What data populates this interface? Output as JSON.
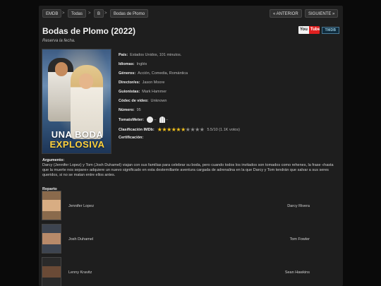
{
  "nav": {
    "breadcrumb": [
      "EMDB",
      "Todas",
      "B",
      "Bodas de Plomo"
    ],
    "separator": ">",
    "prev_label": "« ANTERIOR",
    "next_label": "SIGUIENTE »"
  },
  "movie": {
    "title": "Bodas de Plomo (2022)",
    "reserve_note": "Reserva la fecha.",
    "poster_title_line1": "UNA BODA",
    "poster_title_line2": "EXPLOSIVA"
  },
  "badges": {
    "youtube_you": "You",
    "youtube_tube": "Tube",
    "tmdb": "TMDB"
  },
  "details": [
    {
      "label": "País:",
      "value": "Estados Unidos, 101 minutos."
    },
    {
      "label": "Idiomas:",
      "value": "Inglés"
    },
    {
      "label": "Géneros:",
      "value": "Acción, Comedia, Romántica"
    },
    {
      "label": "Director/es:",
      "value": "Jason Moore"
    },
    {
      "label": "Guionistas:",
      "value": "Mark Hammer"
    },
    {
      "label": "Códec de vídeo:",
      "value": "Unknown"
    },
    {
      "label": "Número:",
      "value": "95"
    }
  ],
  "tomatometer": {
    "label": "TomatoMeter:",
    "critics": "--",
    "audience": "--",
    "critics_icon": "tomato-icon",
    "audience_icon": "popcorn-icon"
  },
  "imdb": {
    "label": "Clasificación IMDb:",
    "score": 5.5,
    "max": 10,
    "text": "5.5/10 (1.1K votos)"
  },
  "certification": {
    "label": "Certificación:",
    "value": ""
  },
  "plot": {
    "label": "Argumento:",
    "text": "Darcy (Jennifer Lopez) y Tom (Josh Duhamel) viajan con sus familias para celebrar su boda, pero cuando todos los invitados son tomados como rehenes, la frase «hasta que la muerte nos separe» adquiere un nuevo significado en esta desternillante aventura cargada de adrenalina en la que Darcy y Tom tendrán que salvar a sus seres queridos, si no se matan entre ellos antes."
  },
  "cast": {
    "label": "Reparto",
    "members": [
      {
        "name": "Jennifer Lopez",
        "role": "Darcy Rivera",
        "photo_colors": [
          "#8a6a4c",
          "#d8ad83"
        ]
      },
      {
        "name": "Josh Duhamel",
        "role": "Tom Fowler",
        "photo_colors": [
          "#3d4450",
          "#b88a6a"
        ]
      },
      {
        "name": "Lenny Kravitz",
        "role": "Sean Hawkins",
        "photo_colors": [
          "#2a2a2a",
          "#6a4a36"
        ]
      }
    ]
  },
  "colors": {
    "background": "#0a0a0a",
    "panel": "#1e1e1e",
    "star": "#f3c21b",
    "youtube_red": "#e02020"
  }
}
